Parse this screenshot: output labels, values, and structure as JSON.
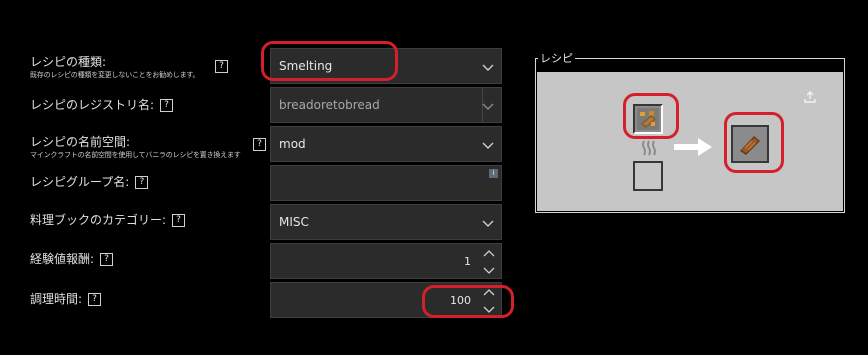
{
  "form": {
    "recipe_type": {
      "label": "レシピの種類:",
      "hint": "既存のレシピの種類を変更しないことをお勧めします。",
      "help": "?",
      "value": "Smelting"
    },
    "registry_name": {
      "label": "レシピのレジストリ名:",
      "help": "?",
      "value": "breadoretobread"
    },
    "namespace": {
      "label": "レシピの名前空間:",
      "hint": "マインクラフトの名前空間を使用してバニラのレシピを置き換えます",
      "help": "?",
      "value": "mod"
    },
    "group": {
      "label": "レシピグループ名:",
      "help": "?",
      "value": "",
      "info": "i"
    },
    "book_category": {
      "label": "料理ブックのカテゴリー:",
      "help": "?",
      "value": "MISC"
    },
    "xp_reward": {
      "label": "経験値報酬:",
      "help": "?",
      "value": "1"
    },
    "cooking_time": {
      "label": "調理時間:",
      "help": "?",
      "value": "100"
    }
  },
  "preview": {
    "legend": "レシピ",
    "export_icon": "upload-icon",
    "input_item_icon": "bread-ore-icon",
    "fuel_icon": "fire-heat-icon",
    "arrow_icon": "arrow-right-icon",
    "output_item_icon": "bread-icon"
  },
  "colors": {
    "highlight": "#d4202a",
    "field_bg": "#2b2b2b",
    "preview_bg": "#c6c6c6"
  }
}
